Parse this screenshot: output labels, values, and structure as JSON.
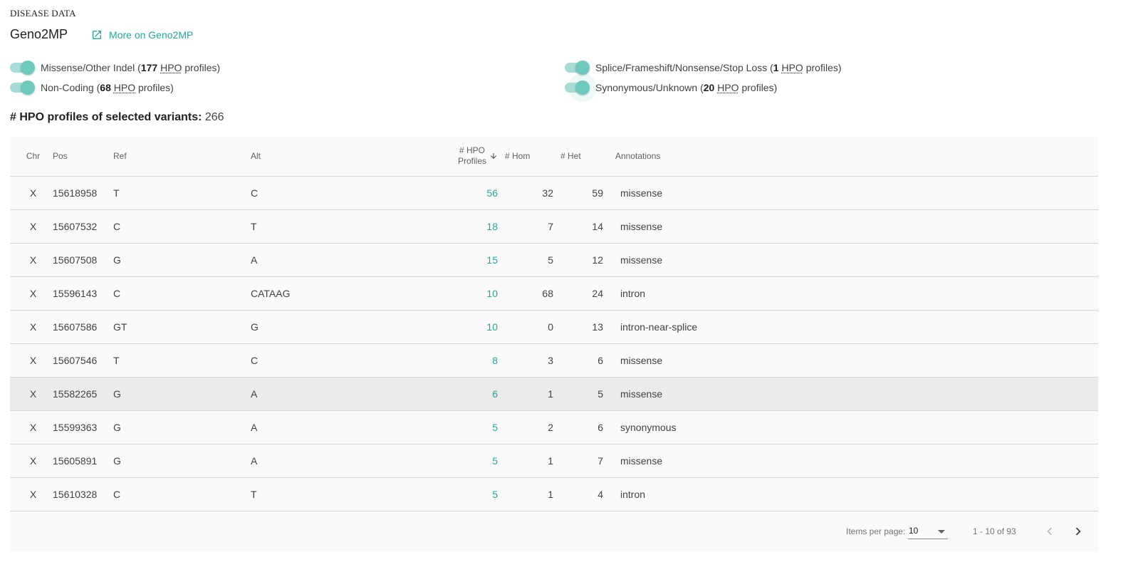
{
  "section": {
    "label": "DISEASE DATA",
    "title": "Geno2MP",
    "link_label": "More on Geno2MP"
  },
  "toggles": [
    {
      "name": "Missense/Other Indel",
      "count": "177",
      "abbr": "HPO",
      "suffix": "profiles)",
      "on": true
    },
    {
      "name": "Non-Coding",
      "count": "68",
      "abbr": "HPO",
      "suffix": "profiles)",
      "on": true
    },
    {
      "name": "Splice/Frameshift/Nonsense/Stop Loss",
      "count": "1",
      "abbr": "HPO",
      "suffix": "profiles)",
      "on": true
    },
    {
      "name": "Synonymous/Unknown",
      "count": "20",
      "abbr": "HPO",
      "suffix": "profiles)",
      "on": true
    }
  ],
  "summary": {
    "label": "# HPO profiles of selected variants:",
    "value": "266"
  },
  "table": {
    "headers": {
      "chr": "Chr",
      "pos": "Pos",
      "ref": "Ref",
      "alt": "Alt",
      "hpo_line1": "# HPO",
      "hpo_line2": "Profiles",
      "hom": "# Hom",
      "het": "# Het",
      "annotations": "Annotations"
    },
    "sort": {
      "column": "# HPO Profiles",
      "direction": "descending"
    },
    "rows": [
      {
        "chr": "X",
        "pos": "15618958",
        "ref": "T",
        "alt": "C",
        "hpo": "56",
        "hom": "32",
        "het": "59",
        "annotation": "missense"
      },
      {
        "chr": "X",
        "pos": "15607532",
        "ref": "C",
        "alt": "T",
        "hpo": "18",
        "hom": "7",
        "het": "14",
        "annotation": "missense"
      },
      {
        "chr": "X",
        "pos": "15607508",
        "ref": "G",
        "alt": "A",
        "hpo": "15",
        "hom": "5",
        "het": "12",
        "annotation": "missense"
      },
      {
        "chr": "X",
        "pos": "15596143",
        "ref": "C",
        "alt": "CATAAG",
        "hpo": "10",
        "hom": "68",
        "het": "24",
        "annotation": "intron"
      },
      {
        "chr": "X",
        "pos": "15607586",
        "ref": "GT",
        "alt": "G",
        "hpo": "10",
        "hom": "0",
        "het": "13",
        "annotation": "intron-near-splice"
      },
      {
        "chr": "X",
        "pos": "15607546",
        "ref": "T",
        "alt": "C",
        "hpo": "8",
        "hom": "3",
        "het": "6",
        "annotation": "missense"
      },
      {
        "chr": "X",
        "pos": "15582265",
        "ref": "G",
        "alt": "A",
        "hpo": "6",
        "hom": "1",
        "het": "5",
        "annotation": "missense"
      },
      {
        "chr": "X",
        "pos": "15599363",
        "ref": "G",
        "alt": "A",
        "hpo": "5",
        "hom": "2",
        "het": "6",
        "annotation": "synonymous"
      },
      {
        "chr": "X",
        "pos": "15605891",
        "ref": "G",
        "alt": "A",
        "hpo": "5",
        "hom": "1",
        "het": "7",
        "annotation": "missense"
      },
      {
        "chr": "X",
        "pos": "15610328",
        "ref": "C",
        "alt": "T",
        "hpo": "5",
        "hom": "1",
        "het": "4",
        "annotation": "intron"
      }
    ]
  },
  "paginator": {
    "items_per_page_label": "Items per page:",
    "items_per_page": "10",
    "range": "1 - 10 of 93"
  },
  "colors": {
    "accent": "#26a69a",
    "toggle_thumb": "#6ec9bf",
    "toggle_track": "#a7dcd6",
    "table_bg": "#fafafa",
    "row_highlight": "#ebebeb"
  },
  "icons": {
    "external_link": "open-in-new-icon",
    "sort": "arrow-down-icon",
    "prev": "chevron-left-icon",
    "next": "chevron-right-icon"
  }
}
